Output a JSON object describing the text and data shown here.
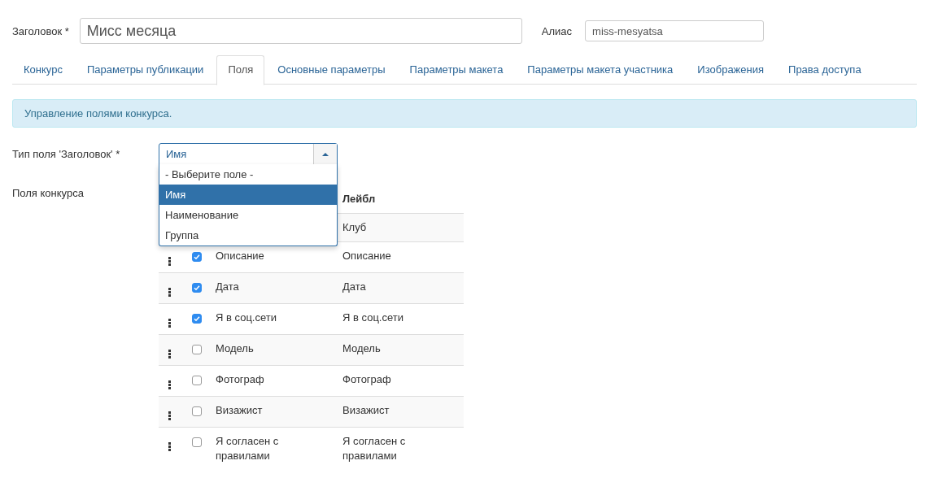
{
  "title_field": {
    "label": "Заголовок *",
    "value": "Мисс месяца"
  },
  "alias_field": {
    "label": "Алиас",
    "value": "miss-mesyatsa"
  },
  "tabs": [
    {
      "label": "Конкурс",
      "selected": false
    },
    {
      "label": "Параметры публикации",
      "selected": false
    },
    {
      "label": "Поля",
      "selected": true
    },
    {
      "label": "Основные параметры",
      "selected": false
    },
    {
      "label": "Параметры макета",
      "selected": false
    },
    {
      "label": "Параметры макета участника",
      "selected": false
    },
    {
      "label": "Изображения",
      "selected": false
    },
    {
      "label": "Права доступа",
      "selected": false
    }
  ],
  "alert": "Управление полями конкурса.",
  "field_type": {
    "label": "Тип поля 'Заголовок' *",
    "value": "Имя",
    "expanded": true,
    "options": [
      {
        "label": "- Выберите поле -",
        "selected": false
      },
      {
        "label": "Имя",
        "selected": true
      },
      {
        "label": "Наименование",
        "selected": false
      },
      {
        "label": "Группа",
        "selected": false
      }
    ]
  },
  "fields": {
    "label": "Поля конкурса",
    "label_header": "Лейбл",
    "rows": [
      {
        "label": "Клуб"
      },
      {
        "name": "Описание",
        "checked": true,
        "label": "Описание"
      },
      {
        "name": "Дата",
        "checked": true,
        "label": "Дата"
      },
      {
        "name": "Я в соц.сети",
        "checked": true,
        "label": "Я в соц.сети"
      },
      {
        "name": "Модель",
        "checked": false,
        "label": "Модель"
      },
      {
        "name": "Фотограф",
        "checked": false,
        "label": "Фотограф"
      },
      {
        "name": "Визажист",
        "checked": false,
        "label": "Визажист"
      },
      {
        "name": "Я согласен с правилами",
        "checked": false,
        "label": "Я согласен с правилами"
      }
    ]
  }
}
